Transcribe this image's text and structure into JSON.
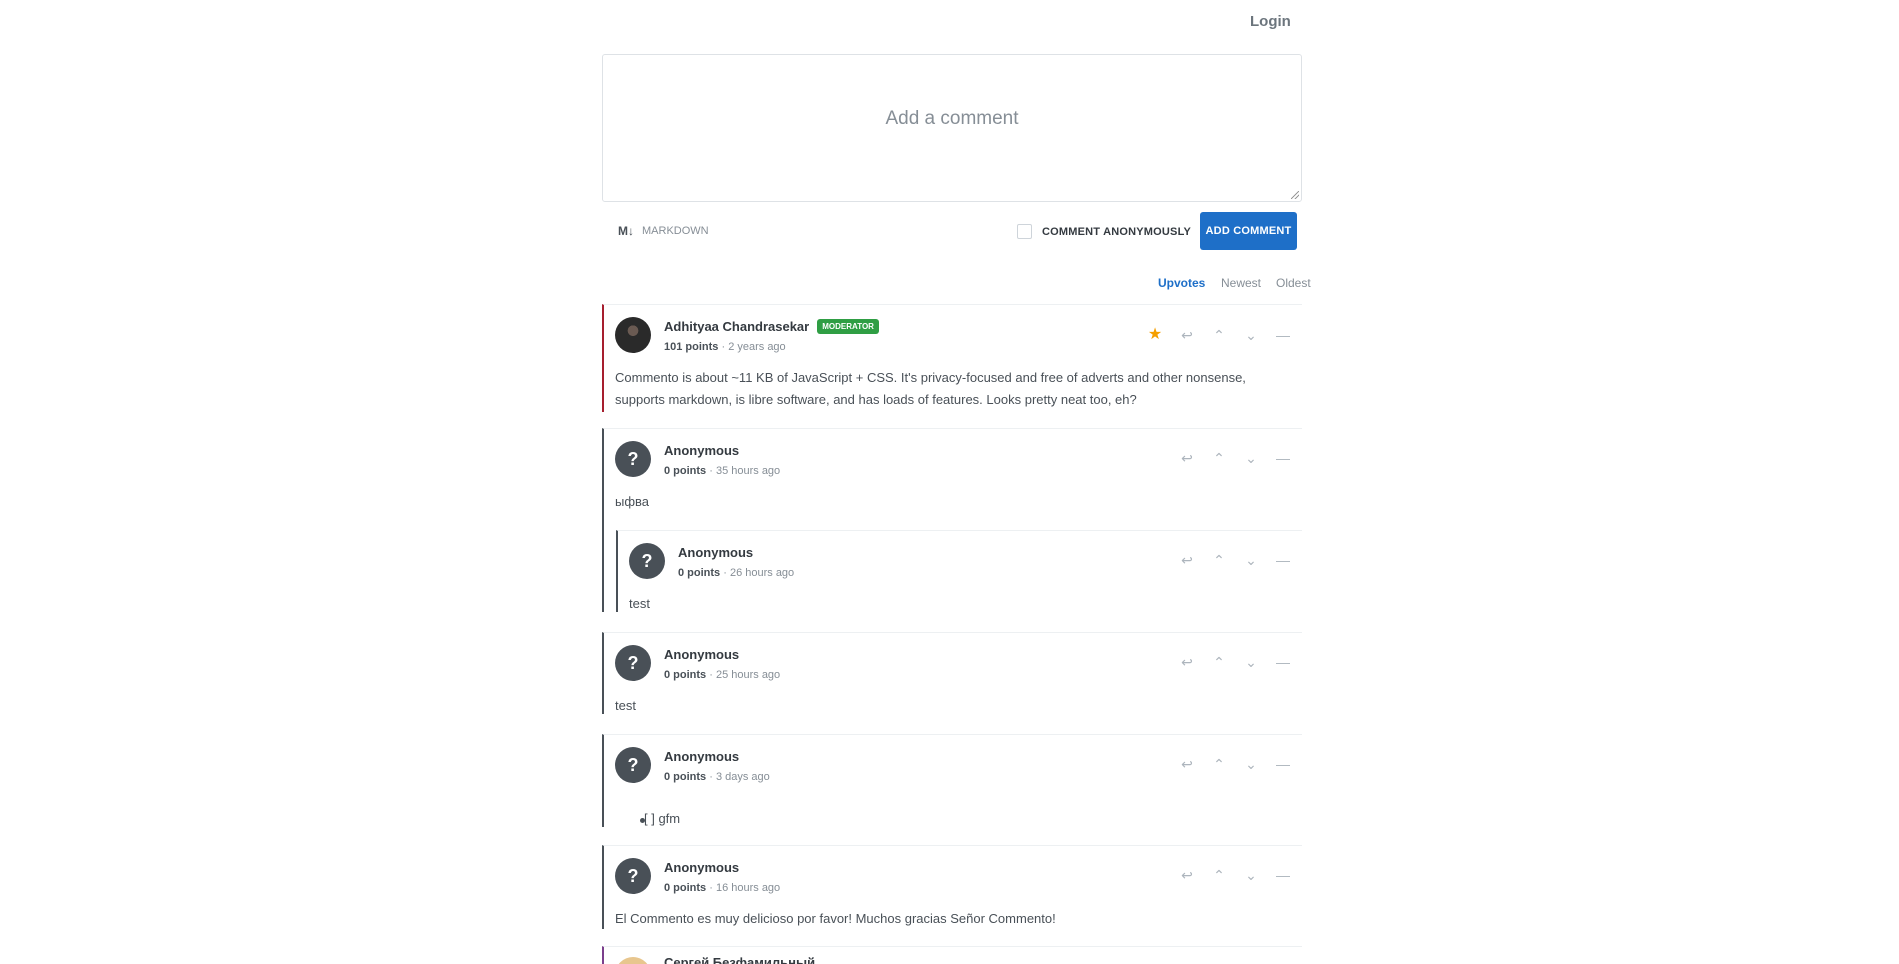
{
  "header": {
    "login_label": "Login"
  },
  "editor": {
    "placeholder": "Add a comment",
    "markdown_icon": "M↓",
    "markdown_label": "MARKDOWN",
    "anonymous_label": "COMMENT ANONYMOUSLY",
    "submit_label": "ADD COMMENT"
  },
  "sort": {
    "upvotes": "Upvotes",
    "newest": "Newest",
    "oldest": "Oldest",
    "active": "Upvotes"
  },
  "icons": {
    "reply": "reply-icon",
    "upvote": "chevron-up-icon",
    "downvote": "chevron-down-icon",
    "collapse": "collapse-icon",
    "sticky": "star-icon"
  },
  "comments": [
    {
      "author": "Adhityaa Chandrasekar",
      "badge": "MODERATOR",
      "points": "101 points",
      "time": "2 years ago",
      "text": "Commento is about ~11 KB of JavaScript + CSS. It's privacy-focused and free of adverts and other nonsense, supports markdown, is libre software, and has loads of features. Looks pretty neat too, eh?"
    },
    {
      "author": "Anonymous",
      "points": "0 points",
      "time": "35 hours ago",
      "text": "ыфва"
    },
    {
      "author": "Anonymous",
      "points": "0 points",
      "time": "26 hours ago",
      "text": "test"
    },
    {
      "author": "Anonymous",
      "points": "0 points",
      "time": "25 hours ago",
      "text": "test"
    },
    {
      "author": "Anonymous",
      "points": "0 points",
      "time": "3 days ago",
      "text": "[ ] gfm"
    },
    {
      "author": "Anonymous",
      "points": "0 points",
      "time": "16 hours ago",
      "text": "El Commento es muy delicioso por favor! Muchos gracias Señor Commento!"
    },
    {
      "author": "Сергей Безфамильный"
    }
  ],
  "avatar_glyph": "?",
  "colors": {
    "accent": "#1e6fc8",
    "moderator_badge": "#2f9e44",
    "sticky_star": "#f59f00",
    "thread_border": "#495057",
    "moderator_border": "#a61e2e"
  }
}
